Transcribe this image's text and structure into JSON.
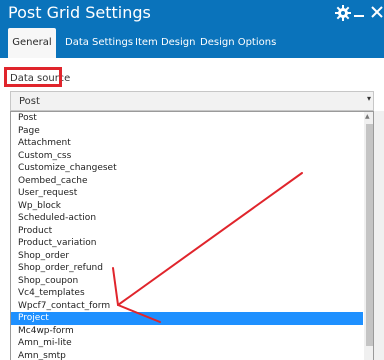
{
  "window": {
    "title": "Post Grid Settings"
  },
  "tabs": [
    {
      "label": "General"
    },
    {
      "label": "Data Settings"
    },
    {
      "label": "Item Design"
    },
    {
      "label": "Design Options"
    }
  ],
  "section": {
    "label": "Data source"
  },
  "select": {
    "value": "Post",
    "caret": "▾"
  },
  "options": [
    "Post",
    "Page",
    "Attachment",
    "Custom_css",
    "Customize_changeset",
    "Oembed_cache",
    "User_request",
    "Wp_block",
    "Scheduled-action",
    "Product",
    "Product_variation",
    "Shop_order",
    "Shop_order_refund",
    "Shop_coupon",
    "Vc4_templates",
    "Wpcf7_contact_form",
    "Project",
    "Mc4wp-form",
    "Amn_mi-lite",
    "Amn_smtp"
  ],
  "selected_option": "Project",
  "colors": {
    "titlebar": "#0a73bb",
    "selected": "#1e90ff",
    "annotation": "#e0252c"
  },
  "icons": [
    "gear-icon",
    "minimize-icon",
    "close-icon",
    "chevron-down-icon"
  ]
}
